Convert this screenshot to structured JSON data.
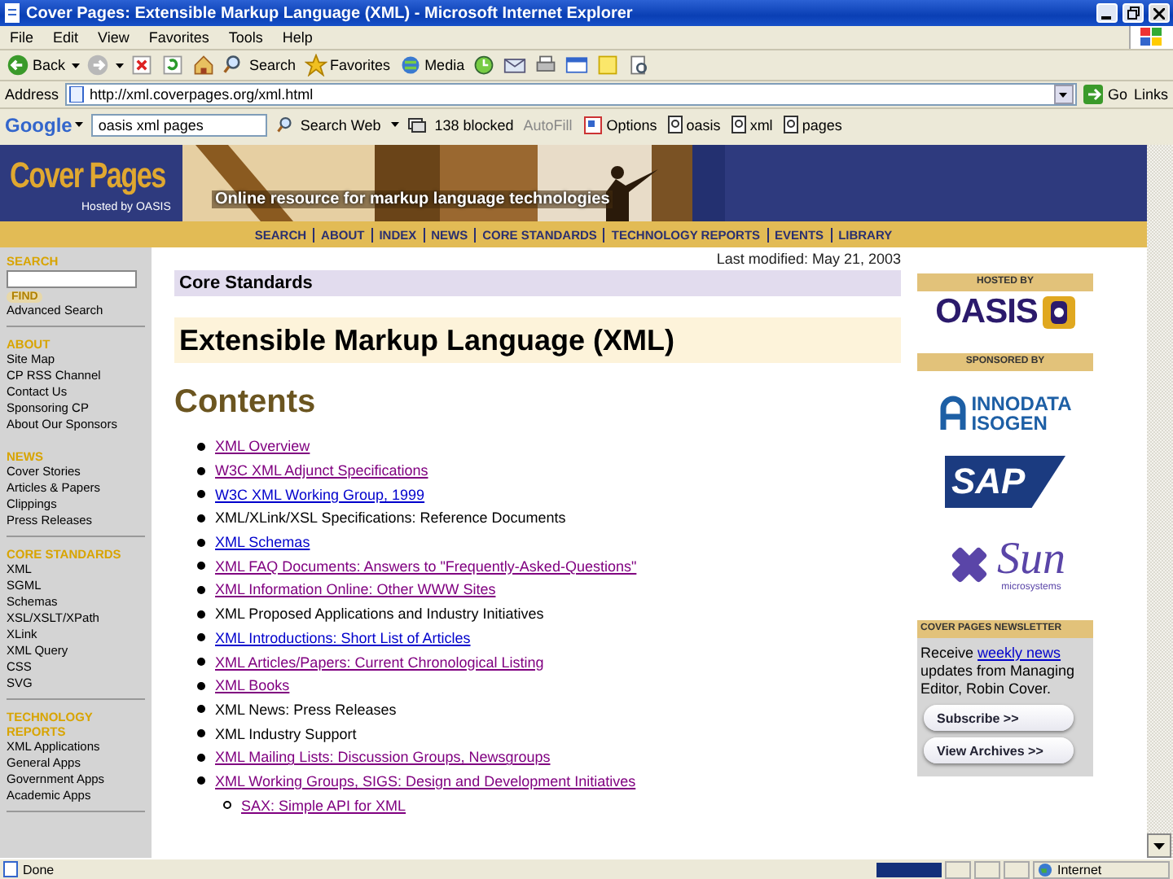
{
  "window": {
    "title": "Cover Pages: Extensible Markup Language (XML) - Microsoft Internet Explorer"
  },
  "menu": [
    "File",
    "Edit",
    "View",
    "Favorites",
    "Tools",
    "Help"
  ],
  "toolbar": [
    {
      "kind": "back",
      "label": "Back"
    },
    {
      "kind": "forward"
    },
    {
      "kind": "stop"
    },
    {
      "kind": "refresh"
    },
    {
      "kind": "home"
    },
    {
      "kind": "search",
      "label": "Search"
    },
    {
      "kind": "favorites",
      "label": "Favorites"
    },
    {
      "kind": "media",
      "label": "Media"
    },
    {
      "kind": "history"
    },
    {
      "kind": "mail"
    },
    {
      "kind": "print"
    },
    {
      "kind": "edit"
    },
    {
      "kind": "note"
    },
    {
      "kind": "research"
    }
  ],
  "address": {
    "label": "Address",
    "value": "http://xml.coverpages.org/xml.html",
    "go": "Go",
    "links": "Links"
  },
  "google_bar": {
    "logo": "Google",
    "query": "oasis xml pages",
    "search": "Search Web",
    "blocked": "138 blocked",
    "autofill": "AutoFill",
    "options": "Options",
    "terms": [
      "oasis",
      "xml",
      "pages"
    ]
  },
  "banner": {
    "title": "Cover Pages",
    "hosted": "Hosted by OASIS",
    "tagline": "Online resource for markup language technologies"
  },
  "nav": [
    "SEARCH",
    "ABOUT",
    "INDEX",
    "NEWS",
    "CORE STANDARDS",
    "TECHNOLOGY REPORTS",
    "EVENTS",
    "LIBRARY"
  ],
  "sidebar": {
    "search_heading": "SEARCH",
    "find": "FIND",
    "advanced": "Advanced Search",
    "sections": [
      {
        "heading": "ABOUT",
        "items": [
          "Site Map",
          "CP RSS Channel",
          "Contact Us",
          "Sponsoring CP",
          "About Our Sponsors"
        ]
      },
      {
        "heading": "NEWS",
        "items": [
          "Cover Stories",
          "Articles & Papers",
          "Clippings",
          "Press Releases"
        ]
      },
      {
        "heading": "CORE STANDARDS",
        "items": [
          "XML",
          "SGML",
          "Schemas",
          "XSL/XSLT/XPath",
          "XLink",
          "XML Query",
          "CSS",
          "SVG"
        ]
      },
      {
        "heading": "TECHNOLOGY REPORTS",
        "items": [
          "XML Applications",
          "General Apps",
          "Government Apps",
          "Academic Apps"
        ]
      }
    ]
  },
  "main": {
    "modified": "Last modified: May 21, 2003",
    "section": "Core Standards",
    "title": "Extensible Markup Language (XML)",
    "contents_heading": "Contents",
    "contents": [
      {
        "text": "XML Overview",
        "kind": "visited"
      },
      {
        "text": "W3C XML Adjunct Specifications",
        "kind": "visited"
      },
      {
        "text": "W3C XML Working Group, 1999",
        "kind": "link"
      },
      {
        "text": "XML/XLink/XSL Specifications: Reference Documents",
        "kind": "text"
      },
      {
        "text": "XML Schemas",
        "kind": "link"
      },
      {
        "text": "XML FAQ Documents: Answers to \"Frequently-Asked-Questions\"",
        "kind": "visited"
      },
      {
        "text": "XML Information Online: Other WWW Sites",
        "kind": "visited"
      },
      {
        "text": "XML Proposed Applications and Industry Initiatives",
        "kind": "text"
      },
      {
        "text": "XML Introductions: Short List of Articles",
        "kind": "link"
      },
      {
        "text": "XML Articles/Papers: Current Chronological Listing",
        "kind": "visited"
      },
      {
        "text": "XML Books",
        "kind": "visited"
      },
      {
        "text": "XML News: Press Releases",
        "kind": "text"
      },
      {
        "text": "XML Industry Support",
        "kind": "text"
      },
      {
        "text": "XML Mailing Lists: Discussion Groups, Newsgroups",
        "kind": "visited"
      },
      {
        "text": "XML Working Groups, SIGS: Design and Development Initiatives",
        "kind": "visited",
        "children": [
          {
            "text": "SAX: Simple API for XML",
            "kind": "visited"
          }
        ]
      }
    ]
  },
  "right": {
    "hosted_heading": "HOSTED BY",
    "hosted_logo": "OASIS",
    "sponsored_heading": "SPONSORED BY",
    "sponsors": [
      {
        "kind": "innodata",
        "lines": [
          "INNODATA",
          "ISOGEN"
        ]
      },
      {
        "kind": "sap",
        "lines": [
          "SAP"
        ]
      },
      {
        "kind": "sun",
        "lines": [
          "Sun",
          "microsystems"
        ]
      }
    ],
    "newsletter": {
      "heading": "COVER PAGES NEWSLETTER",
      "before": "Receive ",
      "link": "weekly news",
      "after": " updates from Managing Editor, Robin Cover.",
      "buttons": [
        "Subscribe >>",
        "View Archives >>"
      ]
    }
  },
  "status_bar": {
    "text": "Done",
    "zone": "Internet"
  }
}
